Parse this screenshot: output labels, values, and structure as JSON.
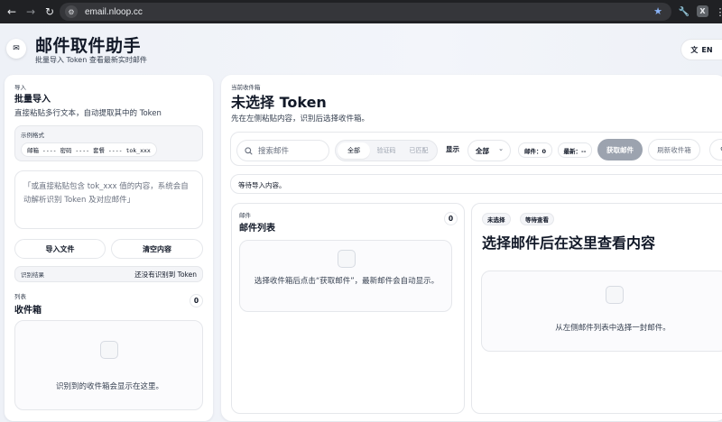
{
  "browser": {
    "url": "email.nloop.cc"
  },
  "header": {
    "title": "邮件取件助手",
    "subtitle": "批量导入 Token 查看最新实时邮件",
    "lang_icon": "文",
    "lang_label": "EN"
  },
  "import_panel": {
    "eyebrow": "导入",
    "title": "批量导入",
    "description": "直接粘贴多行文本，自动提取其中的 Token",
    "format_label": "示例格式",
    "format_example": "邮箱 ---- 密码 ---- 套餐 ---- tok_xxx",
    "textarea_placeholder": "「或直接粘贴包含 tok_xxx 值的内容，系统会自动解析识别 Token 及对应邮件」",
    "import_file_label": "导入文件",
    "clear_label": "清空内容",
    "result_label": "识别结果",
    "result_value": "还没有识别到 Token"
  },
  "inbox_panel": {
    "eyebrow": "列表",
    "title": "收件箱",
    "count": "0",
    "empty_text": "识别到的收件箱会显示在这里。"
  },
  "main": {
    "eyebrow": "当前收件箱",
    "title": "未选择 Token",
    "description": "先在左侧粘贴内容，识别后选择收件箱。"
  },
  "toolbar": {
    "search_placeholder": "搜索邮件",
    "filters": [
      "全部",
      "验证码",
      "已匹配"
    ],
    "display_label": "显示",
    "display_value": "全部",
    "mail_count_chip": "邮件：0",
    "latest_chip": "最新：--",
    "fetch_label": "获取邮件",
    "refresh_label": "刷新收件箱"
  },
  "status": {
    "text": "等待导入内容。"
  },
  "mail_list": {
    "eyebrow": "邮件",
    "title": "邮件列表",
    "count": "0",
    "empty_text": "选择收件箱后点击“获取邮件”，最新邮件会自动显示。"
  },
  "viewer": {
    "tag_unselected": "未选择",
    "tag_waiting": "等待查看",
    "title": "选择邮件后在这里查看内容",
    "empty_text": "从左侧邮件列表中选择一封邮件。"
  },
  "colors": {
    "accent_button": "#9ca3af",
    "page_bg": "#eef1f6",
    "card_bg": "#ffffff",
    "chrome_bg": "#202124"
  }
}
